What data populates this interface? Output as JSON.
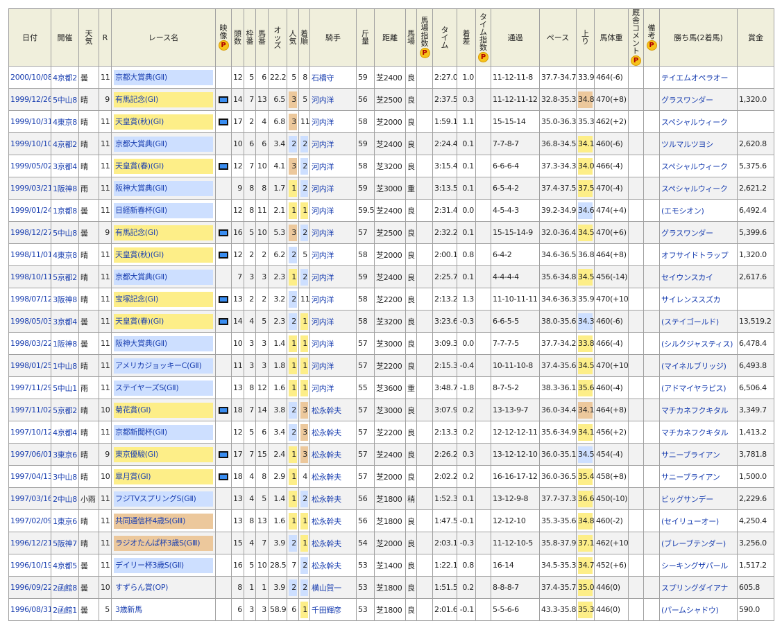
{
  "headers": {
    "date": "日付",
    "kaisai": "開催",
    "weather": "天気",
    "r": "R",
    "race": "レース名",
    "video": "映像",
    "heads": "頭数",
    "waku": "枠番",
    "umaban": "馬番",
    "odds": "オッズ",
    "ninki": "人気",
    "chakujun": "着順",
    "jockey": "騎手",
    "kinryo": "斤量",
    "distance": "距離",
    "baba": "馬場",
    "baba_index": "馬場指数",
    "time": "タイム",
    "margin": "着差",
    "time_index": "タイム指数",
    "passing": "通過",
    "pace": "ペース",
    "agari": "上り",
    "weight": "馬体重",
    "comment": "厩舎コメント",
    "note": "備考",
    "winner": "勝ち馬(2着馬)",
    "prize": "賞金",
    "premium_badge": "P"
  },
  "rows": [
    {
      "date": "2000/10/08",
      "kaisai": "4京都2",
      "weather": "曇",
      "r": "11",
      "race": "京都大賞典(GⅡ)",
      "grade": "g2",
      "video": false,
      "heads": "12",
      "waku": "5",
      "umaban": "6",
      "odds": "22.2",
      "ninki": "5",
      "chakujun": "8",
      "jockey": "石橋守",
      "kinryo": "59",
      "distance": "芝2400",
      "baba": "良",
      "time": "2:27.0",
      "margin": "1.0",
      "passing": "11-12-11-8",
      "pace": "37.7-34.7",
      "agari": "33.9",
      "agari_rank": 0,
      "weight": "464(-6)",
      "winner": "テイエムオペラオー",
      "prize": ""
    },
    {
      "date": "1999/12/26",
      "kaisai": "5中山8",
      "weather": "晴",
      "r": "9",
      "race": "有馬記念(GⅠ)",
      "grade": "g1",
      "video": true,
      "heads": "14",
      "waku": "7",
      "umaban": "13",
      "odds": "6.5",
      "ninki": "3",
      "chakujun": "5",
      "jockey": "河内洋",
      "kinryo": "56",
      "distance": "芝2500",
      "baba": "良",
      "time": "2:37.5",
      "margin": "0.3",
      "passing": "11-12-11-12",
      "pace": "32.8-35.3",
      "agari": "34.8",
      "agari_rank": 3,
      "weight": "470(+8)",
      "winner": "グラスワンダー",
      "prize": "1,320.0"
    },
    {
      "date": "1999/10/31",
      "kaisai": "4東京8",
      "weather": "晴",
      "r": "11",
      "race": "天皇賞(秋)(GⅠ)",
      "grade": "g1",
      "video": true,
      "heads": "17",
      "waku": "2",
      "umaban": "4",
      "odds": "6.8",
      "ninki": "3",
      "chakujun": "11",
      "jockey": "河内洋",
      "kinryo": "58",
      "distance": "芝2000",
      "baba": "良",
      "time": "1:59.1",
      "margin": "1.1",
      "passing": "15-15-14",
      "pace": "35.0-36.3",
      "agari": "35.3",
      "agari_rank": 0,
      "weight": "462(+2)",
      "winner": "スペシャルウィーク",
      "prize": ""
    },
    {
      "date": "1999/10/10",
      "kaisai": "4京都2",
      "weather": "晴",
      "r": "11",
      "race": "京都大賞典(GⅡ)",
      "grade": "g2",
      "video": false,
      "heads": "10",
      "waku": "6",
      "umaban": "6",
      "odds": "3.4",
      "ninki": "2",
      "chakujun": "2",
      "jockey": "河内洋",
      "kinryo": "59",
      "distance": "芝2400",
      "baba": "良",
      "time": "2:24.4",
      "margin": "0.1",
      "passing": "7-7-8-7",
      "pace": "36.8-34.5",
      "agari": "34.1",
      "agari_rank": 1,
      "weight": "460(-6)",
      "winner": "ツルマルツヨシ",
      "prize": "2,620.8"
    },
    {
      "date": "1999/05/02",
      "kaisai": "3京都4",
      "weather": "晴",
      "r": "11",
      "race": "天皇賞(春)(GⅠ)",
      "grade": "g1",
      "video": true,
      "heads": "12",
      "waku": "7",
      "umaban": "10",
      "odds": "4.1",
      "ninki": "3",
      "chakujun": "2",
      "jockey": "河内洋",
      "kinryo": "58",
      "distance": "芝3200",
      "baba": "良",
      "time": "3:15.4",
      "margin": "0.1",
      "passing": "6-6-6-4",
      "pace": "37.3-34.3",
      "agari": "34.0",
      "agari_rank": 1,
      "weight": "466(-4)",
      "winner": "スペシャルウィーク",
      "prize": "5,375.6"
    },
    {
      "date": "1999/03/21",
      "kaisai": "1阪神8",
      "weather": "雨",
      "r": "11",
      "race": "阪神大賞典(GⅡ)",
      "grade": "g2",
      "video": false,
      "heads": "9",
      "waku": "8",
      "umaban": "8",
      "odds": "1.7",
      "ninki": "1",
      "chakujun": "2",
      "jockey": "河内洋",
      "kinryo": "59",
      "distance": "芝3000",
      "baba": "重",
      "time": "3:13.5",
      "margin": "0.1",
      "passing": "6-5-4-2",
      "pace": "37.4-37.5",
      "agari": "37.5",
      "agari_rank": 1,
      "weight": "470(-4)",
      "winner": "スペシャルウィーク",
      "prize": "2,621.2"
    },
    {
      "date": "1999/01/24",
      "kaisai": "1京都8",
      "weather": "曇",
      "r": "11",
      "race": "日経新春杯(GⅡ)",
      "grade": "g2",
      "video": false,
      "heads": "12",
      "waku": "8",
      "umaban": "11",
      "odds": "2.1",
      "ninki": "1",
      "chakujun": "1",
      "jockey": "河内洋",
      "kinryo": "59.5",
      "distance": "芝2400",
      "baba": "良",
      "time": "2:31.4",
      "margin": "0.0",
      "passing": "4-5-4-3",
      "pace": "39.2-34.9",
      "agari": "34.6",
      "agari_rank": 2,
      "weight": "474(+4)",
      "winner": "(エモシオン)",
      "prize": "6,492.4"
    },
    {
      "date": "1998/12/27",
      "kaisai": "5中山8",
      "weather": "曇",
      "r": "9",
      "race": "有馬記念(GⅠ)",
      "grade": "g1",
      "video": true,
      "heads": "16",
      "waku": "5",
      "umaban": "10",
      "odds": "5.3",
      "ninki": "3",
      "chakujun": "2",
      "jockey": "河内洋",
      "kinryo": "57",
      "distance": "芝2500",
      "baba": "良",
      "time": "2:32.2",
      "margin": "0.1",
      "passing": "15-15-14-9",
      "pace": "32.0-36.4",
      "agari": "34.5",
      "agari_rank": 1,
      "weight": "470(+6)",
      "winner": "グラスワンダー",
      "prize": "5,399.6"
    },
    {
      "date": "1998/11/01",
      "kaisai": "4東京8",
      "weather": "晴",
      "r": "11",
      "race": "天皇賞(秋)(GⅠ)",
      "grade": "g1",
      "video": true,
      "heads": "12",
      "waku": "2",
      "umaban": "2",
      "odds": "6.2",
      "ninki": "2",
      "chakujun": "5",
      "jockey": "河内洋",
      "kinryo": "58",
      "distance": "芝2000",
      "baba": "良",
      "time": "2:00.1",
      "margin": "0.8",
      "passing": "6-4-2",
      "pace": "34.6-36.5",
      "agari": "36.8",
      "agari_rank": 0,
      "weight": "464(+8)",
      "winner": "オフサイドトラップ",
      "prize": "1,320.0"
    },
    {
      "date": "1998/10/11",
      "kaisai": "5京都2",
      "weather": "晴",
      "r": "11",
      "race": "京都大賞典(GⅡ)",
      "grade": "g2",
      "video": false,
      "heads": "7",
      "waku": "3",
      "umaban": "3",
      "odds": "2.3",
      "ninki": "1",
      "chakujun": "2",
      "jockey": "河内洋",
      "kinryo": "59",
      "distance": "芝2400",
      "baba": "良",
      "time": "2:25.7",
      "margin": "0.1",
      "passing": "4-4-4-4",
      "pace": "35.6-34.8",
      "agari": "34.5",
      "agari_rank": 1,
      "weight": "456(-14)",
      "winner": "セイウンスカイ",
      "prize": "2,617.6"
    },
    {
      "date": "1998/07/12",
      "kaisai": "3阪神8",
      "weather": "晴",
      "r": "11",
      "race": "宝塚記念(GⅠ)",
      "grade": "g1",
      "video": true,
      "heads": "13",
      "waku": "2",
      "umaban": "2",
      "odds": "3.2",
      "ninki": "2",
      "chakujun": "11",
      "jockey": "河内洋",
      "kinryo": "58",
      "distance": "芝2200",
      "baba": "良",
      "time": "2:13.2",
      "margin": "1.3",
      "passing": "11-10-11-11",
      "pace": "34.6-36.3",
      "agari": "35.9",
      "agari_rank": 0,
      "weight": "470(+10)",
      "winner": "サイレンススズカ",
      "prize": ""
    },
    {
      "date": "1998/05/03",
      "kaisai": "3京都4",
      "weather": "曇",
      "r": "11",
      "race": "天皇賞(春)(GⅠ)",
      "grade": "g1",
      "video": true,
      "heads": "14",
      "waku": "4",
      "umaban": "5",
      "odds": "2.3",
      "ninki": "2",
      "chakujun": "1",
      "jockey": "河内洋",
      "kinryo": "58",
      "distance": "芝3200",
      "baba": "良",
      "time": "3:23.6",
      "margin": "-0.3",
      "passing": "6-6-5-5",
      "pace": "38.0-35.6",
      "agari": "34.3",
      "agari_rank": 2,
      "weight": "460(-6)",
      "winner": "(ステイゴールド)",
      "prize": "13,519.2"
    },
    {
      "date": "1998/03/22",
      "kaisai": "1阪神8",
      "weather": "曇",
      "r": "11",
      "race": "阪神大賞典(GⅡ)",
      "grade": "g2",
      "video": false,
      "heads": "10",
      "waku": "3",
      "umaban": "3",
      "odds": "1.4",
      "ninki": "1",
      "chakujun": "1",
      "jockey": "河内洋",
      "kinryo": "57",
      "distance": "芝3000",
      "baba": "良",
      "time": "3:09.3",
      "margin": "0.0",
      "passing": "7-7-7-5",
      "pace": "37.7-34.2",
      "agari": "33.8",
      "agari_rank": 1,
      "weight": "466(-4)",
      "winner": "(シルクジャスティス)",
      "prize": "6,478.4"
    },
    {
      "date": "1998/01/25",
      "kaisai": "1中山8",
      "weather": "晴",
      "r": "11",
      "race": "アメリカジョッキーC(GⅡ)",
      "grade": "g2",
      "video": false,
      "heads": "11",
      "waku": "3",
      "umaban": "3",
      "odds": "1.8",
      "ninki": "1",
      "chakujun": "1",
      "jockey": "河内洋",
      "kinryo": "57",
      "distance": "芝2200",
      "baba": "良",
      "time": "2:15.3",
      "margin": "-0.4",
      "passing": "10-11-10-8",
      "pace": "37.4-35.6",
      "agari": "34.5",
      "agari_rank": 1,
      "weight": "470(+10)",
      "winner": "(マイネルブリッジ)",
      "prize": "6,493.8"
    },
    {
      "date": "1997/11/29",
      "kaisai": "5中山1",
      "weather": "雨",
      "r": "11",
      "race": "ステイヤーズS(GⅡ)",
      "grade": "g2",
      "video": false,
      "heads": "13",
      "waku": "8",
      "umaban": "12",
      "odds": "1.6",
      "ninki": "1",
      "chakujun": "1",
      "jockey": "河内洋",
      "kinryo": "55",
      "distance": "芝3600",
      "baba": "重",
      "time": "3:48.7",
      "margin": "-1.8",
      "passing": "8-7-5-2",
      "pace": "38.3-36.1",
      "agari": "35.6",
      "agari_rank": 1,
      "weight": "460(-4)",
      "winner": "(アドマイヤラピス)",
      "prize": "6,506.4"
    },
    {
      "date": "1997/11/02",
      "kaisai": "5京都2",
      "weather": "晴",
      "r": "10",
      "race": "菊花賞(GⅠ)",
      "grade": "g1",
      "video": true,
      "heads": "18",
      "waku": "7",
      "umaban": "14",
      "odds": "3.8",
      "ninki": "2",
      "chakujun": "3",
      "jockey": "松永幹夫",
      "kinryo": "57",
      "distance": "芝3000",
      "baba": "良",
      "time": "3:07.9",
      "margin": "0.2",
      "passing": "13-13-9-7",
      "pace": "36.0-34.4",
      "agari": "34.1",
      "agari_rank": 3,
      "weight": "464(+8)",
      "winner": "マチカネフクキタル",
      "prize": "3,349.7"
    },
    {
      "date": "1997/10/12",
      "kaisai": "4京都4",
      "weather": "晴",
      "r": "11",
      "race": "京都新聞杯(GⅡ)",
      "grade": "g2",
      "video": false,
      "heads": "12",
      "waku": "5",
      "umaban": "6",
      "odds": "3.4",
      "ninki": "2",
      "chakujun": "3",
      "jockey": "松永幹夫",
      "kinryo": "57",
      "distance": "芝2200",
      "baba": "良",
      "time": "2:13.3",
      "margin": "0.2",
      "passing": "12-12-12-11",
      "pace": "35.6-34.9",
      "agari": "34.1",
      "agari_rank": 1,
      "weight": "456(+2)",
      "winner": "マチカネフクキタル",
      "prize": "1,413.2"
    },
    {
      "date": "1997/06/01",
      "kaisai": "3東京6",
      "weather": "晴",
      "r": "9",
      "race": "東京優駿(GⅠ)",
      "grade": "g1",
      "video": true,
      "heads": "17",
      "waku": "7",
      "umaban": "15",
      "odds": "2.4",
      "ninki": "1",
      "chakujun": "3",
      "jockey": "松永幹夫",
      "kinryo": "57",
      "distance": "芝2400",
      "baba": "良",
      "time": "2:26.2",
      "margin": "0.3",
      "passing": "13-12-12-10",
      "pace": "36.0-35.1",
      "agari": "34.5",
      "agari_rank": 2,
      "weight": "454(-4)",
      "winner": "サニーブライアン",
      "prize": "3,781.8"
    },
    {
      "date": "1997/04/13",
      "kaisai": "3中山8",
      "weather": "晴",
      "r": "10",
      "race": "皐月賞(GⅠ)",
      "grade": "g1",
      "video": true,
      "heads": "18",
      "waku": "4",
      "umaban": "8",
      "odds": "2.9",
      "ninki": "1",
      "chakujun": "4",
      "jockey": "松永幹夫",
      "kinryo": "57",
      "distance": "芝2000",
      "baba": "良",
      "time": "2:02.2",
      "margin": "0.2",
      "passing": "16-16-17-12",
      "pace": "36.0-36.5",
      "agari": "35.4",
      "agari_rank": 1,
      "weight": "458(+8)",
      "winner": "サニーブライアン",
      "prize": "1,500.0"
    },
    {
      "date": "1997/03/16",
      "kaisai": "2中山8",
      "weather": "小雨",
      "r": "11",
      "race": "フジTVスプリングS(GⅡ)",
      "grade": "g2",
      "video": false,
      "heads": "13",
      "waku": "4",
      "umaban": "5",
      "odds": "1.4",
      "ninki": "1",
      "chakujun": "2",
      "jockey": "松永幹夫",
      "kinryo": "56",
      "distance": "芝1800",
      "baba": "稍",
      "time": "1:52.3",
      "margin": "0.1",
      "passing": "13-12-9-8",
      "pace": "37.7-37.3",
      "agari": "36.6",
      "agari_rank": 1,
      "weight": "450(-10)",
      "winner": "ビッグサンデー",
      "prize": "2,229.6"
    },
    {
      "date": "1997/02/09",
      "kaisai": "1東京6",
      "weather": "晴",
      "r": "11",
      "race": "共同通信杯4歳S(GⅢ)",
      "grade": "g3",
      "video": false,
      "heads": "13",
      "waku": "8",
      "umaban": "13",
      "odds": "1.6",
      "ninki": "1",
      "chakujun": "1",
      "jockey": "松永幹夫",
      "kinryo": "56",
      "distance": "芝1800",
      "baba": "良",
      "time": "1:47.5",
      "margin": "-0.1",
      "passing": "12-12-10",
      "pace": "35.3-35.6",
      "agari": "34.8",
      "agari_rank": 1,
      "weight": "460(-2)",
      "winner": "(セイリューオー)",
      "prize": "4,250.4"
    },
    {
      "date": "1996/12/21",
      "kaisai": "5阪神7",
      "weather": "晴",
      "r": "11",
      "race": "ラジオたんぱ杯3歳S(GⅢ)",
      "grade": "g3",
      "video": false,
      "heads": "15",
      "waku": "4",
      "umaban": "7",
      "odds": "3.9",
      "ninki": "2",
      "chakujun": "1",
      "jockey": "松永幹夫",
      "kinryo": "54",
      "distance": "芝2000",
      "baba": "良",
      "time": "2:03.1",
      "margin": "-0.3",
      "passing": "11-12-10-5",
      "pace": "35.8-37.9",
      "agari": "37.1",
      "agari_rank": 1,
      "weight": "462(+10)",
      "winner": "(ブレーブテンダー)",
      "prize": "3,256.0"
    },
    {
      "date": "1996/10/19",
      "kaisai": "4京都5",
      "weather": "曇",
      "r": "11",
      "race": "デイリー杯3歳S(GⅡ)",
      "grade": "g2",
      "video": false,
      "heads": "16",
      "waku": "5",
      "umaban": "10",
      "odds": "28.5",
      "ninki": "7",
      "chakujun": "2",
      "jockey": "松永幹夫",
      "kinryo": "53",
      "distance": "芝1400",
      "baba": "良",
      "time": "1:22.1",
      "margin": "0.8",
      "passing": "16-14",
      "pace": "34.5-35.3",
      "agari": "34.7",
      "agari_rank": 1,
      "weight": "452(+6)",
      "winner": "シーキングザパール",
      "prize": "1,517.2"
    },
    {
      "date": "1996/09/22",
      "kaisai": "2函館8",
      "weather": "曇",
      "r": "10",
      "race": "すずらん賞(OP)",
      "grade": "",
      "video": false,
      "heads": "8",
      "waku": "1",
      "umaban": "1",
      "odds": "3.9",
      "ninki": "2",
      "chakujun": "2",
      "jockey": "横山賀一",
      "kinryo": "53",
      "distance": "芝1800",
      "baba": "良",
      "time": "1:51.5",
      "margin": "0.2",
      "passing": "8-8-8-7",
      "pace": "37.4-35.7",
      "agari": "35.0",
      "agari_rank": 1,
      "weight": "446(0)",
      "winner": "スプリングダイアナ",
      "prize": "605.8"
    },
    {
      "date": "1996/08/31",
      "kaisai": "2函館1",
      "weather": "曇",
      "r": "5",
      "race": "3歳新馬",
      "grade": "",
      "video": false,
      "heads": "6",
      "waku": "3",
      "umaban": "3",
      "odds": "58.9",
      "ninki": "6",
      "chakujun": "1",
      "jockey": "千田輝彦",
      "kinryo": "53",
      "distance": "芝1800",
      "baba": "良",
      "time": "2:01.6",
      "margin": "-0.1",
      "passing": "5-5-6-6",
      "pace": "43.3-35.8",
      "agari": "35.3",
      "agari_rank": 1,
      "weight": "446(0)",
      "winner": "(パームシャドウ)",
      "prize": "590.0"
    }
  ]
}
